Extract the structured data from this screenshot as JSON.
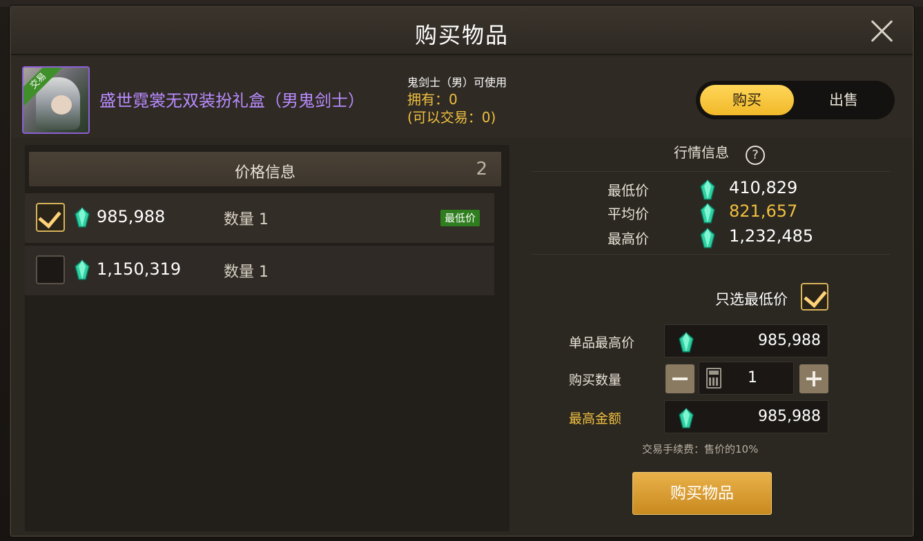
{
  "dialog": {
    "title": "购买物品",
    "close_icon": "close-icon"
  },
  "item": {
    "name": "盛世霓裳无双装扮礼盒（男鬼剑士）",
    "badge": "交易",
    "usable_by": "鬼剑士（男）可使用",
    "owned": "拥有：0",
    "tradable": "(可以交易：0)"
  },
  "mode_toggle": {
    "buy": "购买",
    "sell": "出售",
    "selected": "购买"
  },
  "price_info": {
    "title": "价格信息",
    "count": "2",
    "listings": [
      {
        "checked": true,
        "price": "985,988",
        "qty": "数量 1",
        "badge": "最低价"
      },
      {
        "checked": false,
        "price": "1,150,319",
        "qty": "数量 1",
        "badge": ""
      }
    ]
  },
  "market": {
    "title": "行情信息",
    "help_icon": "?",
    "lowest_label": "最低价",
    "lowest": "410,829",
    "avg_label": "平均价",
    "avg": "821,657",
    "highest_label": "最高价",
    "highest": "1,232,485"
  },
  "purchase_form": {
    "only_lowest_label": "只选最低价",
    "only_lowest_checked": true,
    "max_unit_price_label": "单品最高价",
    "max_unit_price": "985,988",
    "quantity_label": "购买数量",
    "quantity": "1",
    "max_total_label": "最高金额",
    "max_total": "985,988",
    "fee_note": "交易手续费：售价的10%",
    "buy_button": "购买物品"
  },
  "colors": {
    "accent_gold": "#f0c040",
    "item_name_purple": "#b98cff",
    "badge_green": "#2e7d1e",
    "buy_button": "#e9b14a"
  },
  "icons": {
    "currency": "green-gem-icon",
    "calculator": "calculator-icon",
    "help": "question-circle-icon"
  }
}
